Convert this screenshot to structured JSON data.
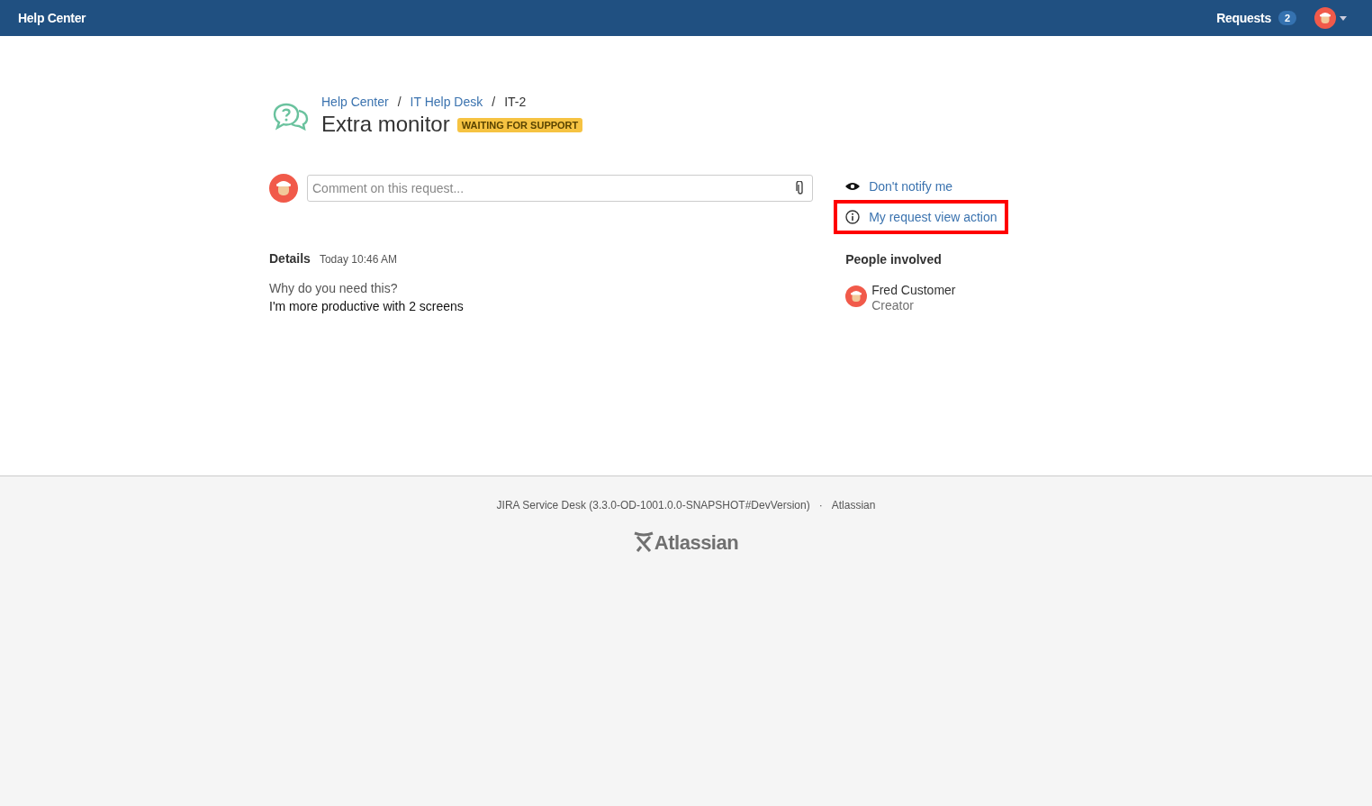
{
  "header": {
    "title": "Help Center",
    "requests_label": "Requests",
    "requests_count": "2"
  },
  "breadcrumbs": [
    {
      "label": "Help Center",
      "link": true
    },
    {
      "label": "IT Help Desk",
      "link": true
    },
    {
      "label": "IT-2",
      "link": false
    }
  ],
  "breadcrumb_separator": "/",
  "request": {
    "title": "Extra monitor",
    "status": "WAITING FOR SUPPORT"
  },
  "comment": {
    "placeholder": "Comment on this request..."
  },
  "details": {
    "heading": "Details",
    "time": "Today 10:46 AM",
    "question": "Why do you need this?",
    "answer": "I'm more productive with 2 screens"
  },
  "actions": [
    {
      "kind": "eye",
      "label": "Don't notify me",
      "highlighted": false
    },
    {
      "kind": "info",
      "label": "My request view action",
      "highlighted": true
    }
  ],
  "people": {
    "heading": "People involved",
    "items": [
      {
        "name": "Fred Customer",
        "role": "Creator"
      }
    ]
  },
  "footer": {
    "version": "JIRA Service Desk (3.3.0-OD-1001.0.0-SNAPSHOT#DevVersion)",
    "separator": "·",
    "company": "Atlassian",
    "logo": "Atlassian"
  }
}
